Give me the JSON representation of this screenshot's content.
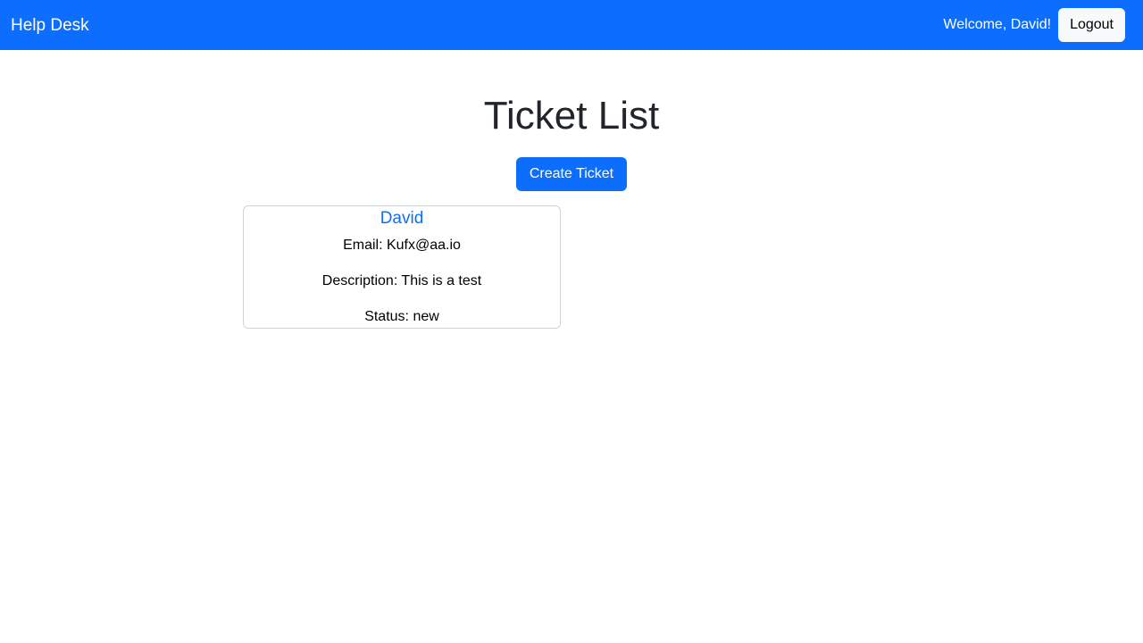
{
  "navbar": {
    "brand": "Help Desk",
    "welcome": "Welcome, David!",
    "logout_label": "Logout"
  },
  "main": {
    "title": "Ticket List",
    "create_label": "Create Ticket"
  },
  "tickets": [
    {
      "name": "David",
      "email": "Email: Kufx@aa.io",
      "description": "Description: This is a test",
      "status": "Status: new"
    }
  ],
  "colors": {
    "primary": "#0d6efd",
    "light_button": "#f8f9fa",
    "card_border": "#cfd4d9",
    "text": "#212529"
  }
}
